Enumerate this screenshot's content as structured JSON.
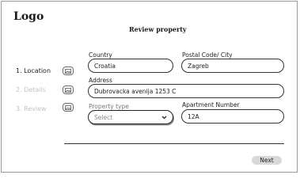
{
  "header": {
    "logo": "Logo",
    "title": "Review property"
  },
  "steps": [
    {
      "label": "1. Location",
      "state": "active"
    },
    {
      "label": "2. Details",
      "state": "inactive"
    },
    {
      "label": "3. Review",
      "state": "inactive"
    }
  ],
  "step_icon": "image-icon",
  "form": {
    "country": {
      "label": "Country",
      "value": "Croatia"
    },
    "postal_city": {
      "label": "Postal Code/ City",
      "value": "Zagreb"
    },
    "address": {
      "label": "Address",
      "value": "Dubrovacka avenija 1253 C"
    },
    "property_type": {
      "label": "Property type",
      "placeholder": "Select"
    },
    "apartment_number": {
      "label": "Apartment Number",
      "value": "12A"
    }
  },
  "actions": {
    "next": "Next"
  }
}
